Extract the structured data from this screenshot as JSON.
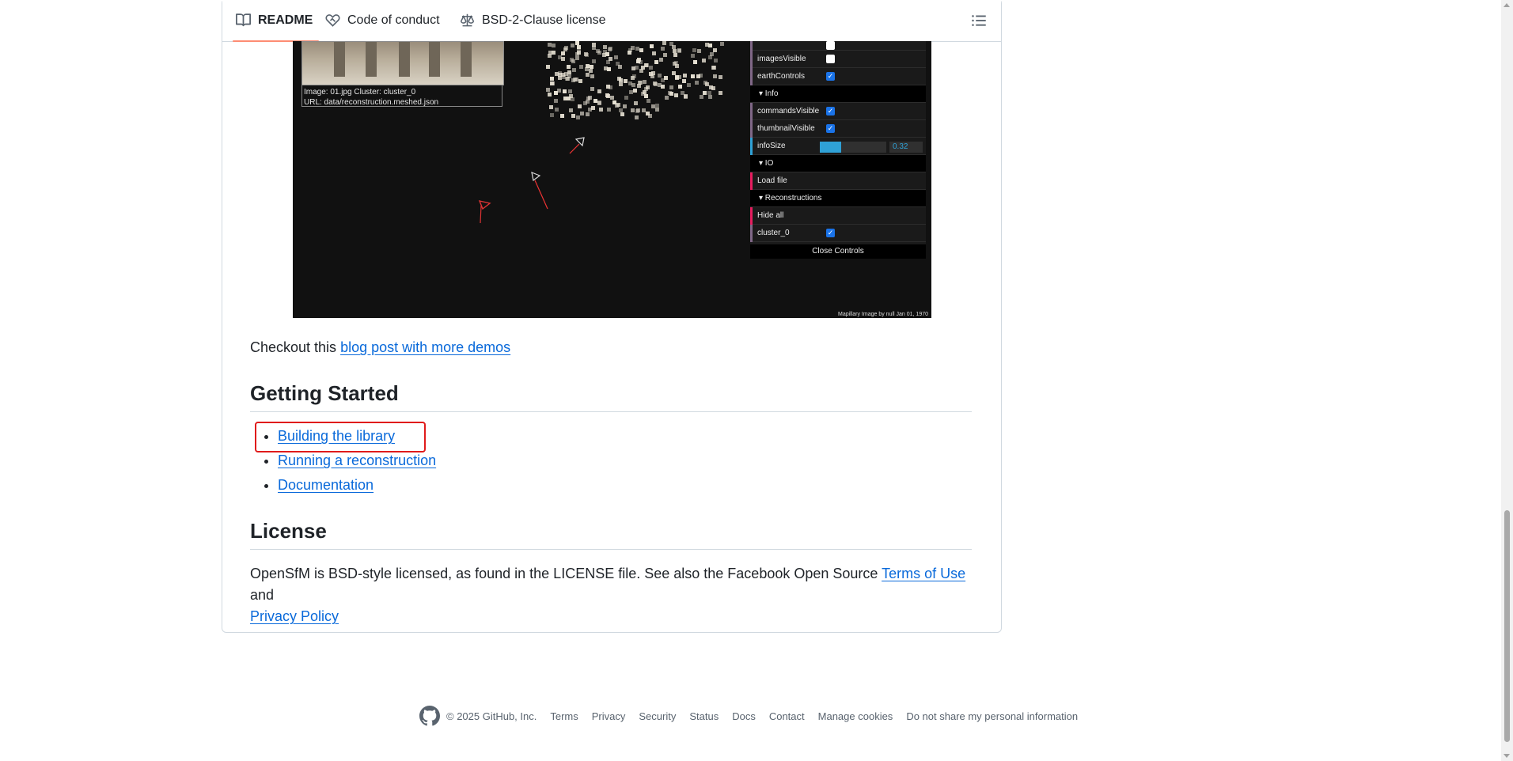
{
  "tabs": [
    {
      "label": "README",
      "icon": "book-icon",
      "active": true
    },
    {
      "label": "Code of conduct",
      "icon": "heart-handshake-icon",
      "active": false
    },
    {
      "label": "BSD-2-Clause license",
      "icon": "scale-icon",
      "active": false
    }
  ],
  "screenshot": {
    "caption_line1": "Image: 01.jpg Cluster: cluster_0",
    "caption_line2": "URL: data/reconstruction.meshed.json",
    "panel": {
      "row_imagesVisible": "imagesVisible",
      "row_earthControls": "earthControls",
      "head_info": "▾ Info",
      "row_commandsVisible": "commandsVisible",
      "row_thumbnailVisible": "thumbnailVisible",
      "row_infoSize": "infoSize",
      "infoSize_value": "0.32",
      "infoSize_fraction": 0.32,
      "head_io": "▾ IO",
      "row_loadFile": "Load file",
      "head_reconstructions": "▾ Reconstructions",
      "row_hideAll": "Hide all",
      "row_cluster": "cluster_0",
      "close": "Close Controls"
    },
    "attribution": "Mapillary   Image by null  Jan 01, 1970"
  },
  "checkout": {
    "prefix": "Checkout this ",
    "link": "blog post with more demos"
  },
  "getting_started": {
    "heading": "Getting Started",
    "items": [
      "Building the library",
      "Running a reconstruction",
      "Documentation"
    ]
  },
  "license": {
    "heading": "License",
    "text_before": "OpenSfM is BSD-style licensed, as found in the LICENSE file. See also the Facebook Open Source ",
    "terms_link": "Terms of Use",
    "and": " and",
    "privacy_link": "Privacy Policy"
  },
  "footer": {
    "copyright": "© 2025 GitHub, Inc.",
    "links": [
      "Terms",
      "Privacy",
      "Security",
      "Status",
      "Docs",
      "Contact",
      "Manage cookies",
      "Do not share my personal information"
    ]
  }
}
